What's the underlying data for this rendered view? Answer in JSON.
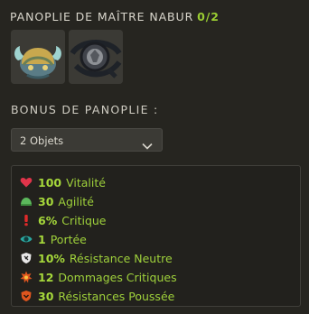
{
  "panoply": {
    "title": "PANOPLIE DE MAÎTRE NABUR",
    "count": "0/2",
    "items": [
      {
        "icon": "horned-helmet-icon"
      },
      {
        "icon": "amulet-icon"
      }
    ]
  },
  "bonus": {
    "section_label": "BONUS DE PANOPLIE :",
    "selected_option": "2 Objets",
    "rows": [
      {
        "icon": "heart-icon",
        "value": "100",
        "label": "Vitalité"
      },
      {
        "icon": "agility-icon",
        "value": "30",
        "label": "Agilité"
      },
      {
        "icon": "critical-icon",
        "value": "6%",
        "label": "Critique"
      },
      {
        "icon": "eye-icon",
        "value": "1",
        "label": "Portée"
      },
      {
        "icon": "neutral-resistance-icon",
        "value": "10%",
        "label": "Résistance Neutre"
      },
      {
        "icon": "critical-damage-icon",
        "value": "12",
        "label": "Dommages Critiques"
      },
      {
        "icon": "push-resistance-icon",
        "value": "30",
        "label": "Résistances Poussée"
      }
    ]
  },
  "colors": {
    "background": "#262520",
    "accent_green": "#9fd13b"
  }
}
